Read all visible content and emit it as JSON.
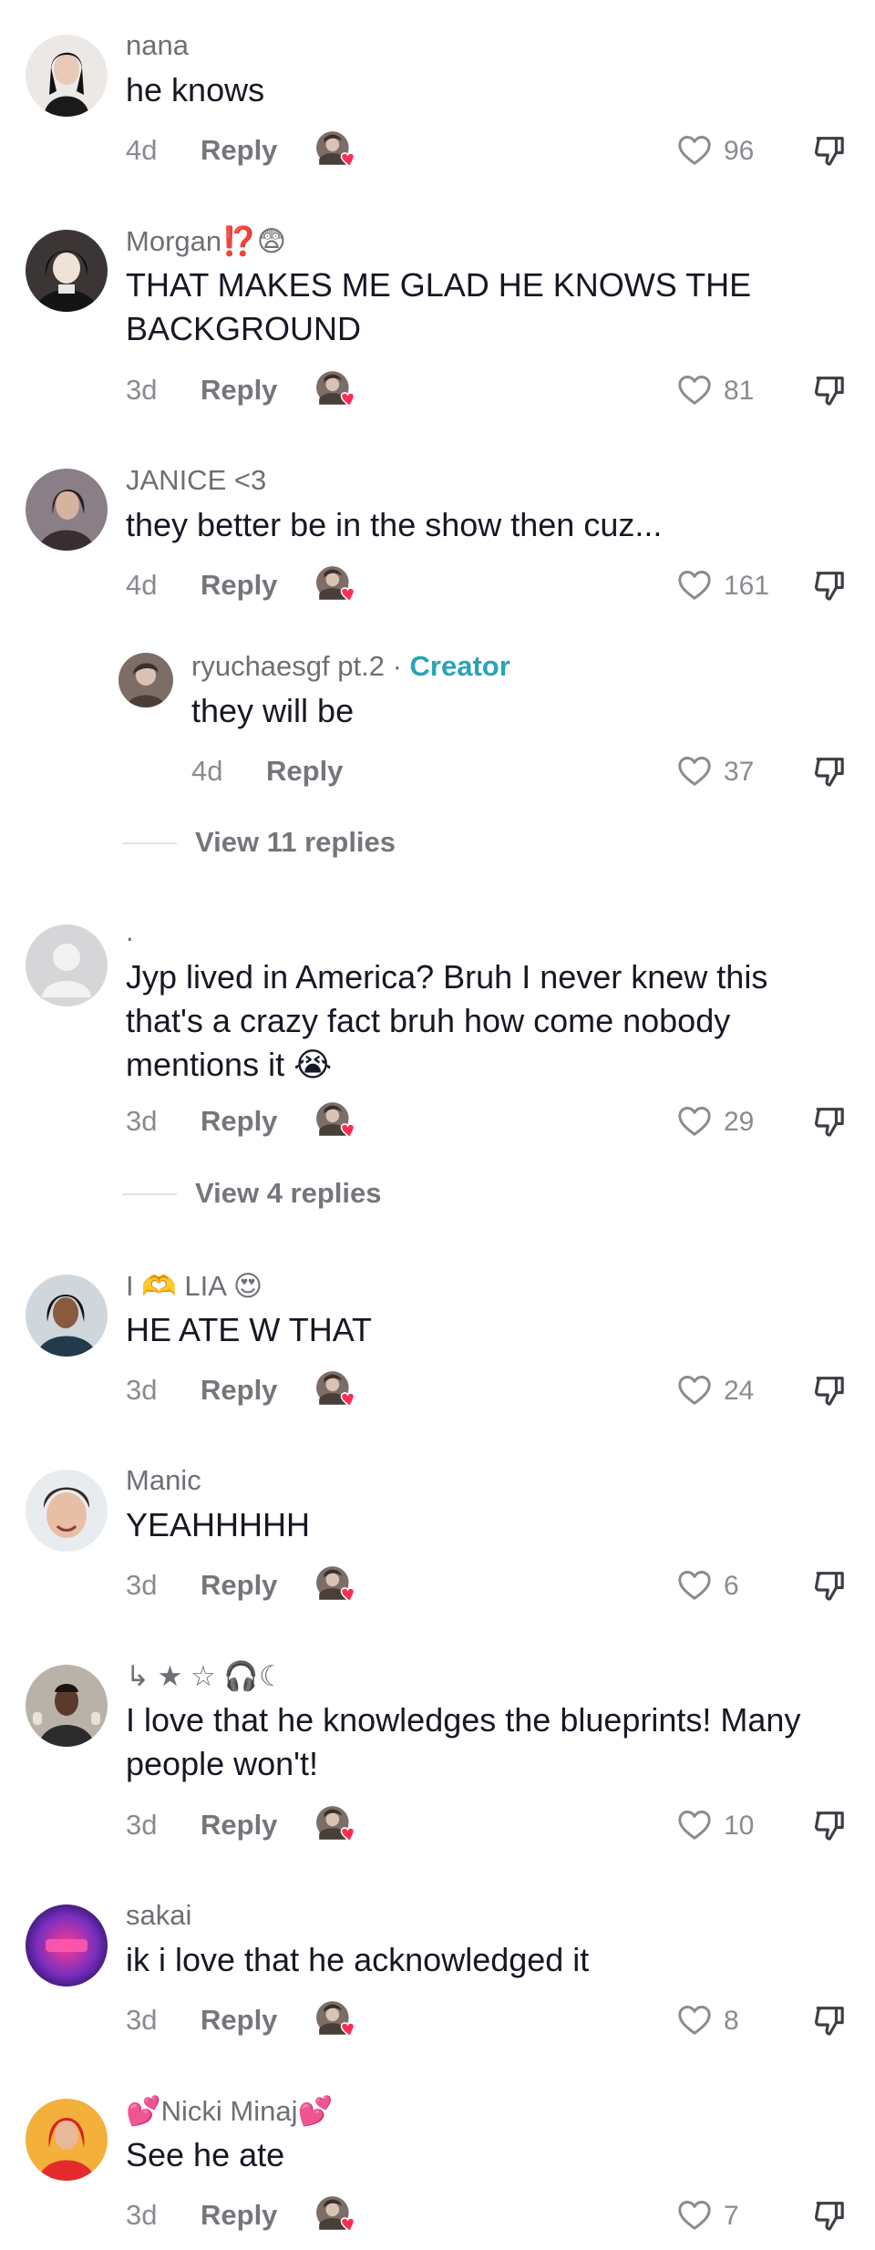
{
  "comments": [
    {
      "username": "nana",
      "text": "he knows",
      "age": "4d",
      "reply_label": "Reply",
      "likes": "96"
    },
    {
      "username": "Morgan⁉️😨",
      "text": "THAT MAKES ME GLAD HE KNOWS THE BACKGROUND",
      "age": "3d",
      "reply_label": "Reply",
      "likes": "81"
    },
    {
      "username": "JANICE <3",
      "text": "they better be in the show then cuz...",
      "age": "4d",
      "reply_label": "Reply",
      "likes": "161",
      "reply": {
        "username": "ryuchaesgf pt.2",
        "separator": "·",
        "badge": "Creator",
        "text": "they will be",
        "age": "4d",
        "reply_label": "Reply",
        "likes": "37"
      },
      "view_replies": "View 11 replies"
    },
    {
      "username": ".",
      "text": "Jyp lived in America? Bruh I never knew this that's a crazy fact bruh how come nobody mentions it 😭",
      "age": "3d",
      "reply_label": "Reply",
      "likes": "29",
      "view_replies": "View 4 replies"
    },
    {
      "username": "I 🫶 LIA 😍",
      "text": "HE ATE W THAT",
      "age": "3d",
      "reply_label": "Reply",
      "likes": "24"
    },
    {
      "username": "Manic",
      "text": "YEAHHHHH",
      "age": "3d",
      "reply_label": "Reply",
      "likes": "6"
    },
    {
      "username": "↳ ★ ☆ 🎧☾",
      "text": "I love that he knowledges the blueprints! Many people won't!",
      "age": "3d",
      "reply_label": "Reply",
      "likes": "10"
    },
    {
      "username": "sakai",
      "text": "ik i love that he acknowledged it",
      "age": "3d",
      "reply_label": "Reply",
      "likes": "8"
    },
    {
      "username": "💕Nicki Minaj💕",
      "text": "See he ate",
      "age": "3d",
      "reply_label": "Reply",
      "likes": "7"
    }
  ],
  "colors": {
    "creator_badge": "#29a3b8",
    "liked_heart": "#fe2c55"
  },
  "icons": {
    "like": "heart-outline-icon",
    "dislike": "thumbs-down-icon",
    "creator_liked": "creator-liked-avatar-icon"
  }
}
